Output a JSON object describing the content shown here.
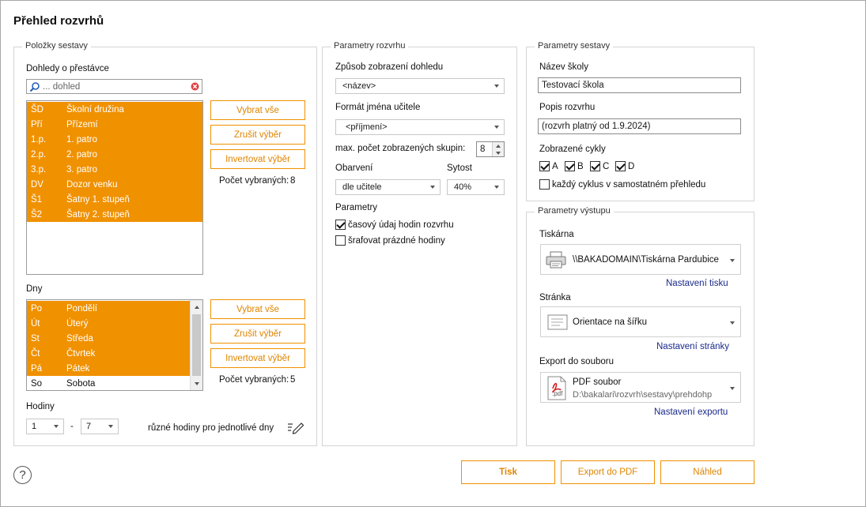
{
  "window": {
    "title": "Přehled rozvrhů"
  },
  "items_group": {
    "legend": "Položky sestavy",
    "supervisions_label": "Dohledy o přestávce",
    "search_placeholder": "... dohled",
    "supervisions": [
      {
        "code": "ŠD",
        "name": "Školní družina"
      },
      {
        "code": "Pří",
        "name": "Přízemí"
      },
      {
        "code": "1.p.",
        "name": "1. patro"
      },
      {
        "code": "2.p.",
        "name": "2. patro"
      },
      {
        "code": "3.p.",
        "name": "3. patro"
      },
      {
        "code": "DV",
        "name": "Dozor venku"
      },
      {
        "code": "Š1",
        "name": "Šatny 1. stupeň"
      },
      {
        "code": "Š2",
        "name": "Šatny 2. stupeň"
      }
    ],
    "select_all": "Vybrat vše",
    "clear_selection": "Zrušit výběr",
    "invert_selection": "Invertovat výběr",
    "selected_count_label": "Počet vybraných:",
    "supervisions_selected": "8",
    "days_label": "Dny",
    "days": [
      {
        "code": "Po",
        "name": "Pondělí",
        "selected": true
      },
      {
        "code": "Út",
        "name": "Úterý",
        "selected": true
      },
      {
        "code": "St",
        "name": "Středa",
        "selected": true
      },
      {
        "code": "Čt",
        "name": "Čtvrtek",
        "selected": true
      },
      {
        "code": "Pá",
        "name": "Pátek",
        "selected": true
      },
      {
        "code": "So",
        "name": "Sobota",
        "selected": false
      }
    ],
    "days_selected": "5",
    "hours_label": "Hodiny",
    "hour_from": "1",
    "hour_dash": "-",
    "hour_to": "7",
    "diff_hours_label": "různé hodiny pro jednotlivé dny"
  },
  "schedule_group": {
    "legend": "Parametry rozvrhu",
    "display_mode_label": "Způsob zobrazení dohledu",
    "display_mode_value": "<název>",
    "teacher_format_label": "Formát jména učitele",
    "teacher_format_value": "<příjmení>",
    "max_groups_label": "max. počet zobrazených skupin:",
    "max_groups_value": "8",
    "coloring_label": "Obarvení",
    "coloring_value": "dle učitele",
    "saturation_label": "Sytost",
    "saturation_value": "40%",
    "params_label": "Parametry",
    "opt_time": "časový údaj hodin rozvrhu",
    "opt_time_checked": true,
    "opt_hatch": "šrafovat prázdné hodiny",
    "opt_hatch_checked": false
  },
  "report_group": {
    "legend": "Parametry sestavy",
    "school_name_label": "Název školy",
    "school_name_value": "Testovací škola",
    "schedule_desc_label": "Popis rozvrhu",
    "schedule_desc_value": "(rozvrh platný od 1.9.2024)",
    "cycles_label": "Zobrazené cykly",
    "cycles": [
      {
        "label": "A",
        "checked": true
      },
      {
        "label": "B",
        "checked": true
      },
      {
        "label": "C",
        "checked": true
      },
      {
        "label": "D",
        "checked": true
      }
    ],
    "each_cycle_label": "každý cyklus v samostatném přehledu",
    "each_cycle_checked": false
  },
  "output_group": {
    "legend": "Parametry výstupu",
    "printer_label": "Tiskárna",
    "printer_value": "\\\\BAKADOMAIN\\Tiskárna Pardubice",
    "printer_settings_link": "Nastavení tisku",
    "page_label": "Stránka",
    "page_value": "Orientace na šířku",
    "page_settings_link": "Nastavení stránky",
    "export_label": "Export do souboru",
    "export_type": "PDF soubor",
    "export_path": "D:\\bakalari\\rozvrh\\sestavy\\prehdohp",
    "export_icon_text": ".pdf",
    "export_settings_link": "Nastavení exportu"
  },
  "footer": {
    "help_glyph": "?",
    "print_button": "Tisk",
    "export_pdf_button": "Export do PDF",
    "preview_button": "Náhled"
  },
  "colors": {
    "accent": "#f09100",
    "link": "#1a2a8a"
  }
}
